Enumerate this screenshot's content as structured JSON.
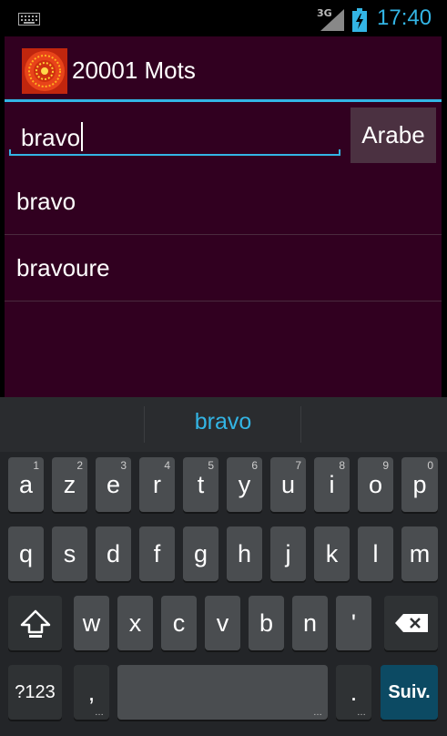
{
  "status": {
    "network": "3G",
    "time": "17:40"
  },
  "app": {
    "title": "20001 Mots"
  },
  "search": {
    "value": "bravo",
    "language_button": "Arabe"
  },
  "results": [
    "bravo",
    "bravoure"
  ],
  "keyboard": {
    "suggestion": "bravo",
    "row1": [
      {
        "label": "a",
        "hint": "1"
      },
      {
        "label": "z",
        "hint": "2"
      },
      {
        "label": "e",
        "hint": "3"
      },
      {
        "label": "r",
        "hint": "4"
      },
      {
        "label": "t",
        "hint": "5"
      },
      {
        "label": "y",
        "hint": "6"
      },
      {
        "label": "u",
        "hint": "7"
      },
      {
        "label": "i",
        "hint": "8"
      },
      {
        "label": "o",
        "hint": "9"
      },
      {
        "label": "p",
        "hint": "0"
      }
    ],
    "row2": [
      "q",
      "s",
      "d",
      "f",
      "g",
      "h",
      "j",
      "k",
      "l",
      "m"
    ],
    "row3": [
      "w",
      "x",
      "c",
      "v",
      "b",
      "n",
      "'"
    ],
    "symbols_label": "?123",
    "comma_label": ",",
    "period_label": ".",
    "action_label": "Suiv.",
    "more_dots": "…"
  }
}
